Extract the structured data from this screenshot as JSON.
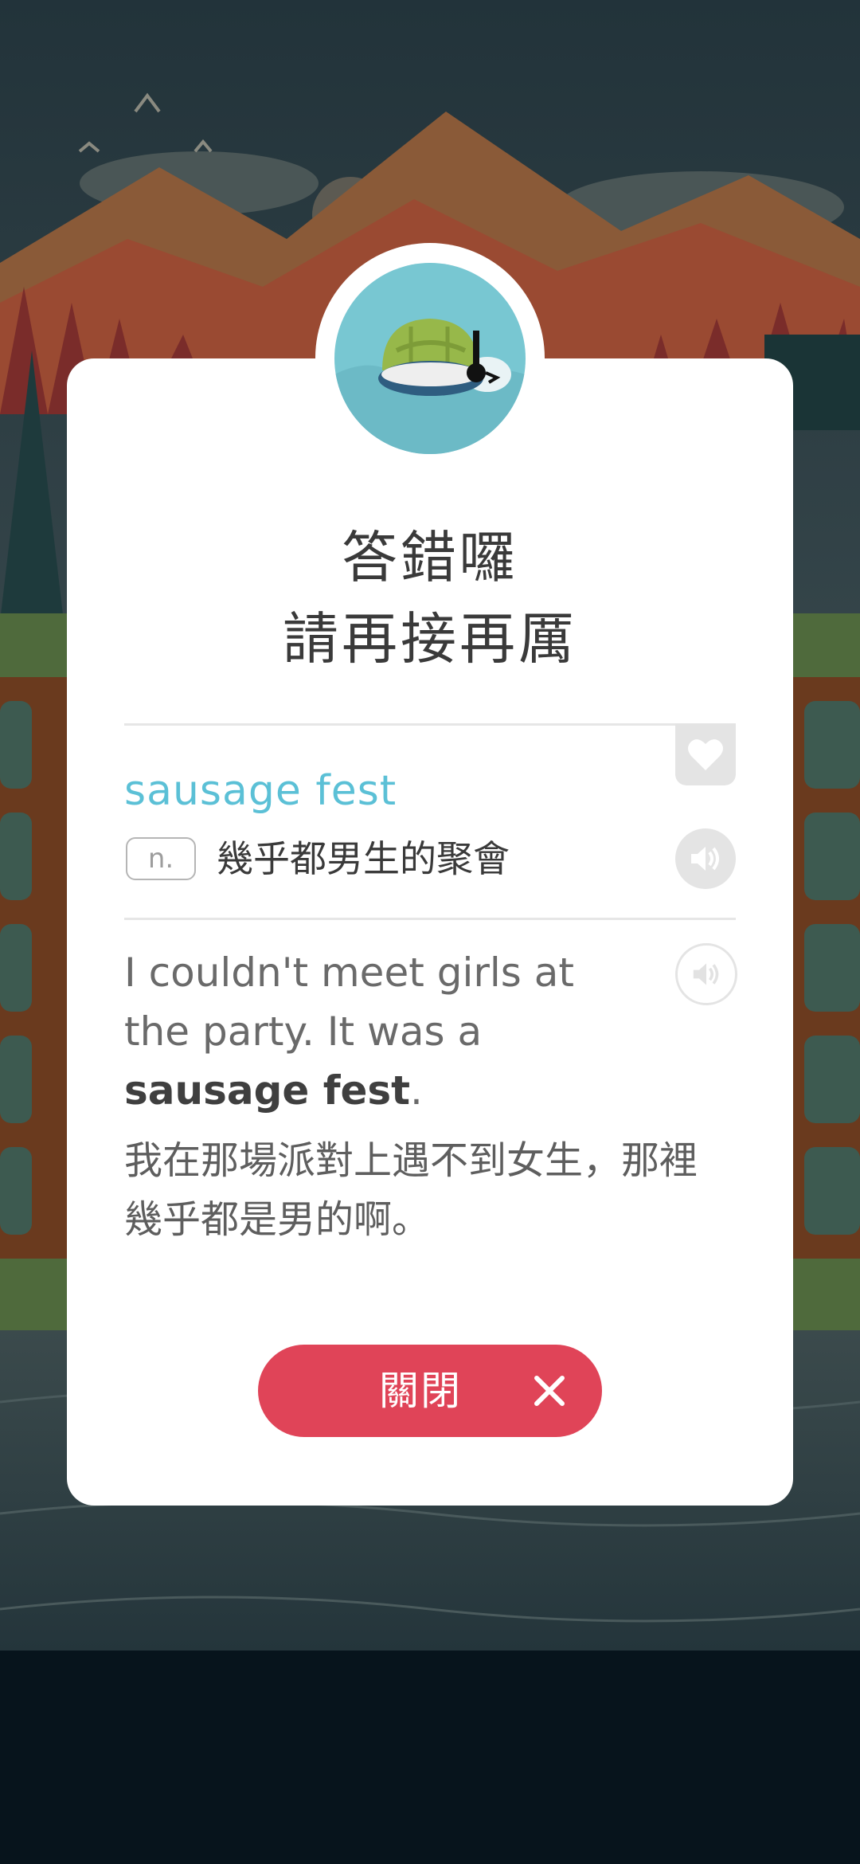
{
  "dialog": {
    "title_line1": "答錯囉",
    "title_line2": "請再接再厲",
    "word": "sausage fest",
    "part_of_speech": "n.",
    "meaning": "幾乎都男生的聚會",
    "example": {
      "before": "I couldn't meet girls at the party. It was a ",
      "highlight": "sausage fest",
      "after": "."
    },
    "translation": "我在那場派對上遇不到女生，那裡幾乎都是男的啊。",
    "close_label": "關閉"
  },
  "icons": {
    "avatar": "turtle-icon",
    "favorite": "heart-icon",
    "word_audio": "speaker-icon",
    "example_audio": "speaker-icon",
    "close": "close-icon"
  },
  "colors": {
    "accent_word": "#5bc0d6",
    "close_button": "#e04458",
    "avatar_bg": "#78c7d2"
  }
}
